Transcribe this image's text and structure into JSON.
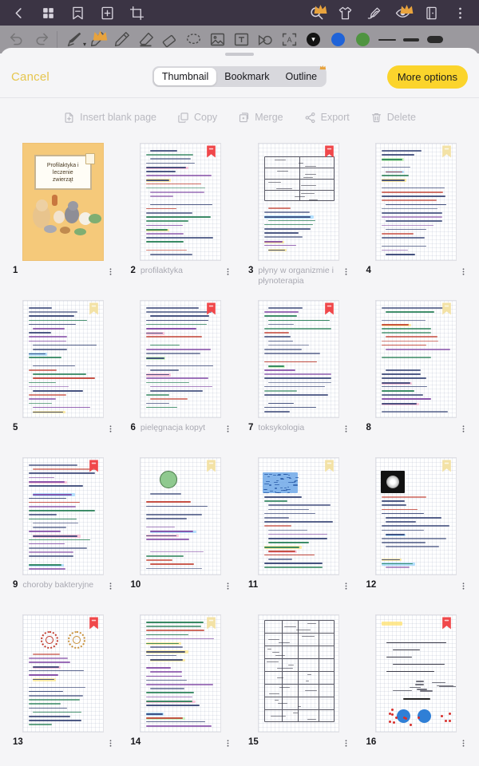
{
  "topbar": {
    "icons_left": [
      {
        "name": "back-chevron-icon",
        "label": "Back"
      },
      {
        "name": "grid-view-icon",
        "label": "Grid view"
      },
      {
        "name": "bookmark-icon",
        "label": "Bookmark"
      },
      {
        "name": "add-page-icon",
        "label": "Add page"
      },
      {
        "name": "crop-icon",
        "label": "Crop"
      }
    ],
    "icons_right": [
      {
        "name": "search-icon",
        "label": "Search",
        "premium": true
      },
      {
        "name": "tshirt-template-icon",
        "label": "Templates",
        "premium": false
      },
      {
        "name": "signature-pen-icon",
        "label": "Sign",
        "premium": false
      },
      {
        "name": "eye-read-icon",
        "label": "Read mode",
        "premium": true
      },
      {
        "name": "page-flip-icon",
        "label": "Page flip",
        "premium": false
      },
      {
        "name": "kebab-menu-icon",
        "label": "More",
        "premium": false
      }
    ]
  },
  "toolbar": {
    "tools": [
      {
        "name": "undo-icon",
        "label": "Undo",
        "disabled": true
      },
      {
        "name": "redo-icon",
        "label": "Redo",
        "disabled": true
      },
      {
        "name": "fountain-pen-icon",
        "label": "Pen",
        "chevron": true
      },
      {
        "name": "pencil-icon",
        "label": "Pencil",
        "premium": true
      },
      {
        "name": "ballpoint-pen-icon",
        "label": "Ballpoint"
      },
      {
        "name": "highlighter-icon",
        "label": "Highlighter"
      },
      {
        "name": "eraser-icon",
        "label": "Eraser"
      },
      {
        "name": "lasso-select-icon",
        "label": "Lasso select"
      },
      {
        "name": "insert-image-icon",
        "label": "Insert image"
      },
      {
        "name": "text-box-icon",
        "label": "Text box"
      },
      {
        "name": "shape-tool-icon",
        "label": "Shapes"
      },
      {
        "name": "ocr-scan-icon",
        "label": "Scan"
      }
    ],
    "colors": [
      {
        "name": "color-swatch-black",
        "hex": "#141414",
        "selected": true
      },
      {
        "name": "color-swatch-blue",
        "hex": "#1f63d8",
        "selected": false
      },
      {
        "name": "color-swatch-green",
        "hex": "#4f9440",
        "selected": false
      }
    ],
    "thickness": [
      {
        "name": "stroke-thin",
        "weight": 2,
        "selected": true
      },
      {
        "name": "stroke-medium",
        "weight": 4,
        "selected": false
      },
      {
        "name": "stroke-thick",
        "weight": 9,
        "selected": false
      }
    ]
  },
  "sheet": {
    "cancel_label": "Cancel",
    "more_options_label": "More options",
    "tabs": [
      {
        "label": "Thumbnail",
        "active": true,
        "premium": false
      },
      {
        "label": "Bookmark",
        "active": false,
        "premium": false
      },
      {
        "label": "Outline",
        "active": false,
        "premium": true
      }
    ],
    "actions": [
      {
        "label": "Insert blank page",
        "icon": "insert-blank-page-icon",
        "enabled": false
      },
      {
        "label": "Copy",
        "icon": "copy-icon",
        "enabled": false
      },
      {
        "label": "Merge",
        "icon": "merge-icon",
        "enabled": false
      },
      {
        "label": "Export",
        "icon": "export-share-icon",
        "enabled": false
      },
      {
        "label": "Delete",
        "icon": "trash-delete-icon",
        "enabled": false
      }
    ]
  },
  "cover": {
    "title_lines": [
      "Profilaktyka i",
      "leczenie",
      "zwierząt"
    ]
  },
  "pages": [
    {
      "num": "1",
      "label": "",
      "bookmark": "",
      "kind": "cover",
      "selected": true
    },
    {
      "num": "2",
      "label": "profilaktyka",
      "bookmark": "red",
      "kind": "notes-a",
      "selected": false
    },
    {
      "num": "3",
      "label": "płyny w organizmie i płynoterapia",
      "bookmark": "red",
      "kind": "table-a",
      "selected": false
    },
    {
      "num": "4",
      "label": "",
      "bookmark": "cream",
      "kind": "notes-b",
      "selected": false
    },
    {
      "num": "5",
      "label": "",
      "bookmark": "cream",
      "kind": "notes-c",
      "selected": false
    },
    {
      "num": "6",
      "label": "pielęgnacja kopyt",
      "bookmark": "red",
      "kind": "notes-d",
      "selected": false
    },
    {
      "num": "7",
      "label": "toksykologia",
      "bookmark": "red",
      "kind": "notes-e",
      "selected": false
    },
    {
      "num": "8",
      "label": "",
      "bookmark": "cream",
      "kind": "notes-f",
      "selected": false
    },
    {
      "num": "9",
      "label": "choroby bakteryjne",
      "bookmark": "red",
      "kind": "notes-g",
      "selected": false
    },
    {
      "num": "10",
      "label": "",
      "bookmark": "cream",
      "kind": "diagram-a",
      "selected": false
    },
    {
      "num": "11",
      "label": "",
      "bookmark": "cream",
      "kind": "scribble",
      "selected": false
    },
    {
      "num": "12",
      "label": "",
      "bookmark": "cream",
      "kind": "micro",
      "selected": false
    },
    {
      "num": "13",
      "label": "",
      "bookmark": "red",
      "kind": "virus",
      "selected": false
    },
    {
      "num": "14",
      "label": "",
      "bookmark": "cream",
      "kind": "notes-h",
      "selected": false
    },
    {
      "num": "15",
      "label": "",
      "bookmark": "",
      "kind": "table-b",
      "selected": false
    },
    {
      "num": "16",
      "label": "",
      "bookmark": "red",
      "kind": "immuno",
      "selected": false
    }
  ],
  "colors": {
    "accent_yellow": "#fbd42c",
    "cancel_yellow": "#e6c64e",
    "topbar_dark": "#3b3444",
    "toolbar_grey": "#9b999e",
    "sheet_bg": "#f5f5f7",
    "bookmark_red": "#f0474a",
    "bookmark_cream": "#f3e2a6",
    "cover_bg": "#f5c97a"
  }
}
